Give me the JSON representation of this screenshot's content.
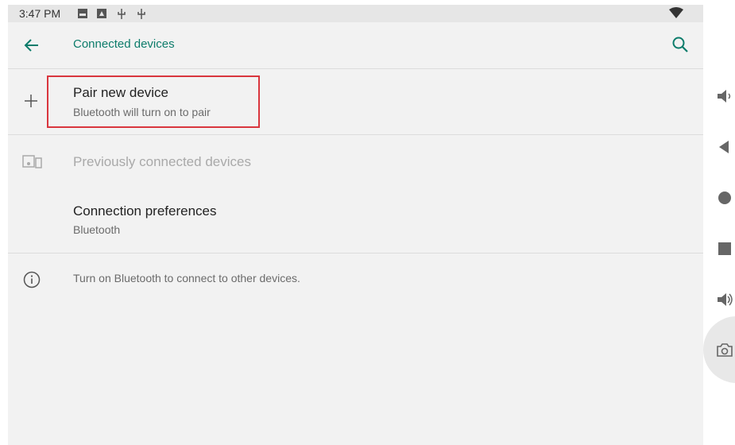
{
  "status_bar": {
    "time": "3:47 PM",
    "icons": [
      "image-icon",
      "photo-icon",
      "usb-icon",
      "usb-icon",
      "wifi-icon"
    ]
  },
  "app_bar": {
    "title": "Connected devices",
    "back_icon": "arrow-back-icon",
    "search_icon": "search-icon"
  },
  "items": [
    {
      "title": "Pair new device",
      "subtitle": "Bluetooth will turn on to pair",
      "icon": "plus-icon"
    },
    {
      "title": "Previously connected devices",
      "icon": "devices-icon"
    },
    {
      "title": "Connection preferences",
      "subtitle": "Bluetooth"
    }
  ],
  "footer_info": {
    "text": "Turn on Bluetooth to connect to other devices.",
    "icon": "info-icon"
  },
  "side_nav": [
    "volume-down-icon",
    "back-icon",
    "home-icon",
    "recents-icon",
    "volume-up-icon",
    "camera-icon"
  ],
  "colors": {
    "accent": "#0c7c6b",
    "highlight_box": "#d9363e",
    "background": "#f2f2f2"
  }
}
